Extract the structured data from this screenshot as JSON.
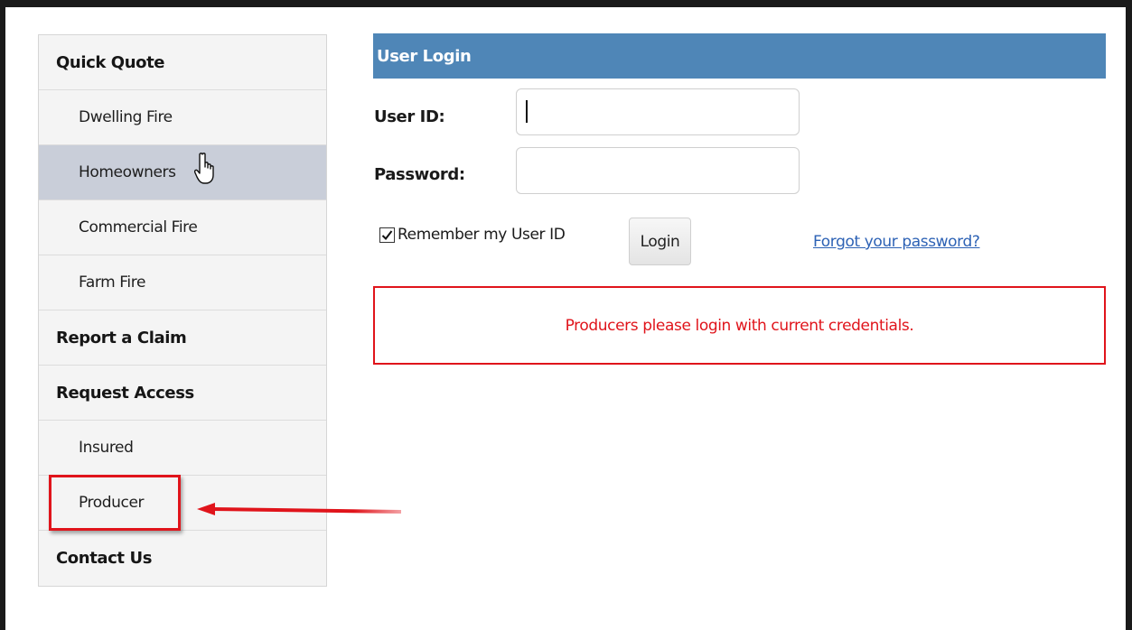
{
  "sidebar": {
    "items": [
      {
        "label": "Quick Quote",
        "type": "head"
      },
      {
        "label": "Dwelling Fire",
        "type": "sub"
      },
      {
        "label": "Homeowners",
        "type": "sub",
        "hovered": true
      },
      {
        "label": "Commercial Fire",
        "type": "sub"
      },
      {
        "label": "Farm Fire",
        "type": "sub"
      },
      {
        "label": "Report a Claim",
        "type": "head"
      },
      {
        "label": "Request Access",
        "type": "head"
      },
      {
        "label": "Insured",
        "type": "sub"
      },
      {
        "label": "Producer",
        "type": "sub",
        "highlighted": true
      },
      {
        "label": "Contact Us",
        "type": "head"
      }
    ]
  },
  "login": {
    "title": "User Login",
    "user_id_label": "User ID:",
    "user_id_value": "",
    "password_label": "Password:",
    "password_value": "",
    "remember_label": "Remember my User ID",
    "remember_checked": true,
    "login_button": "Login",
    "forgot_link": "Forgot your password?"
  },
  "notice": {
    "message": "Producers please login with current credentials."
  },
  "colors": {
    "header_bg": "#4f86b7",
    "alert_red": "#e0141b",
    "link_blue": "#2d62b5",
    "hover_bg": "#c9ced9"
  },
  "icons": [
    "hand-pointer-cursor-icon",
    "checkmark-icon",
    "red-arrow-annotation"
  ]
}
